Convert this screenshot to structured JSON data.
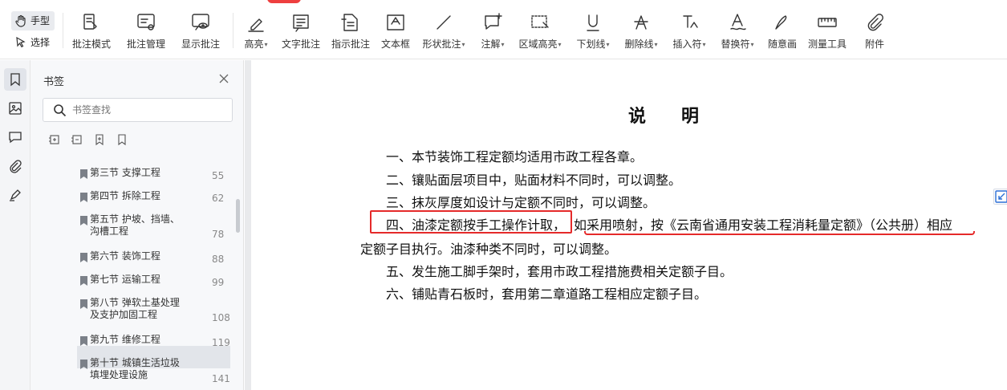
{
  "toolbar": {
    "modes": {
      "hand": "手型",
      "select": "选择"
    },
    "tools": [
      {
        "label": "批注模式",
        "dropdown": false
      },
      {
        "label": "批注管理",
        "dropdown": false
      },
      {
        "label": "显示批注",
        "dropdown": false
      },
      {
        "label": "高亮",
        "dropdown": true
      },
      {
        "label": "文字批注",
        "dropdown": false
      },
      {
        "label": "指示批注",
        "dropdown": false
      },
      {
        "label": "文本框",
        "dropdown": false
      },
      {
        "label": "形状批注",
        "dropdown": true
      },
      {
        "label": "注解",
        "dropdown": true
      },
      {
        "label": "区域高亮",
        "dropdown": true
      },
      {
        "label": "下划线",
        "dropdown": true
      },
      {
        "label": "删除线",
        "dropdown": true
      },
      {
        "label": "插入符",
        "dropdown": true
      },
      {
        "label": "替换符",
        "dropdown": true
      },
      {
        "label": "随意画",
        "dropdown": false
      },
      {
        "label": "测量工具",
        "dropdown": false
      },
      {
        "label": "附件",
        "dropdown": false
      }
    ],
    "caret": "▾"
  },
  "bookmarks": {
    "title": "书签",
    "search_placeholder": "书签查找",
    "items": [
      {
        "line1": "第三节 支撑工程",
        "line2": "",
        "page": "55"
      },
      {
        "line1": "第四节 拆除工程",
        "line2": "",
        "page": "62"
      },
      {
        "line1": "第五节 护坡、挡墙、",
        "line2": "沟槽工程",
        "page": "78"
      },
      {
        "line1": "第六节 装饰工程",
        "line2": "",
        "page": "88",
        "selected": true
      },
      {
        "line1": "第七节 运输工程",
        "line2": "",
        "page": "99"
      },
      {
        "line1": "第八节 弹软土基处理",
        "line2": "及支护加固工程",
        "page": "108"
      },
      {
        "line1": "第九节 维修工程",
        "line2": "",
        "page": "119"
      },
      {
        "line1": "第十节 城镇生活垃圾",
        "line2": "填埋处理设施",
        "page": "141"
      }
    ]
  },
  "document": {
    "title": "说明",
    "lines": {
      "l1": "一、本节装饰工程定额均适用市政工程各章。",
      "l2": "二、镶贴面层项目中，贴面材料不同时，可以调整。",
      "l3": "三、抹灰厚度如设计与定额不同时，可以调整。",
      "l4a": "四、油漆定额按手工操作计取，",
      "l4b": "如采用喷射，按《云南省通用安装工程消耗量定额》（公共册）相应",
      "l4c": "定额子目执行。油漆种类不同时，可以调整。",
      "l5": "五、发生施工脚手架时，套用市政工程措施费相关定额子目。",
      "l6": "六、铺贴青石板时，套用第二章道路工程相应定额子目。"
    }
  },
  "colors": {
    "annotation_red": "#e52a2a",
    "tab_red": "#ee3f3f"
  }
}
